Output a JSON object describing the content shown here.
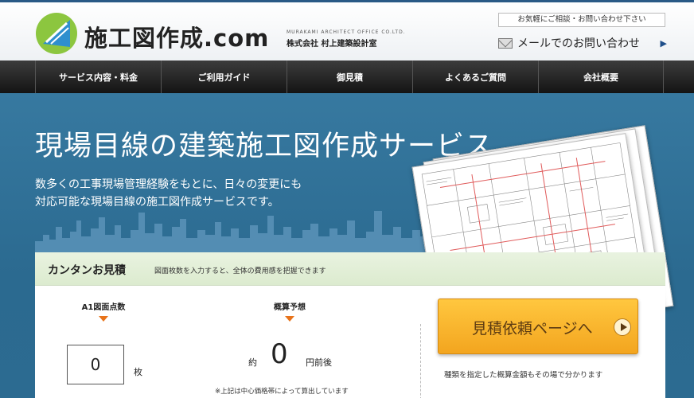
{
  "header": {
    "logo_text": "施工図作成.com",
    "company_en": "MURAKAMI ARCHITECT OFFICE CO.LTD.",
    "company_jp": "株式会社 村上建築設計室",
    "contact_note": "お気軽にご相談・お問い合わせ下さい",
    "mail_label": "メールでのお問い合わせ",
    "mail_arrow": "▶"
  },
  "nav": {
    "items": [
      {
        "label": "サービス内容・料金"
      },
      {
        "label": "ご利用ガイド"
      },
      {
        "label": "御見積"
      },
      {
        "label": "よくあるご質問"
      },
      {
        "label": "会社概要"
      }
    ]
  },
  "hero": {
    "title": "現場目線の建築施工図作成サービス",
    "desc_line1": "数多くの工事現場管理経験をもとに、日々の変更にも",
    "desc_line2": "対応可能な現場目線の施工図作成サービスです。"
  },
  "estimate": {
    "title": "カンタンお見積",
    "note": "図面枚数を入力すると、全体の費用感を把握できます",
    "col1_label": "A1図面点数",
    "col2_label": "概算予想",
    "count_value": "0",
    "count_unit": "枚",
    "approx_prefix": "約",
    "approx_value": "0",
    "approx_unit": "円前後",
    "footnote": "※上記は中心価格帯によって算出しています",
    "cta_label": "見積依頼ページへ",
    "cta_sub": "種類を指定した概算金額もその場で分かります"
  },
  "colors": {
    "accent_orange": "#f3a51f",
    "nav_dark": "#1a1a1a",
    "hero_blue": "#2e6f95",
    "panel_green": "#e2eed6"
  }
}
